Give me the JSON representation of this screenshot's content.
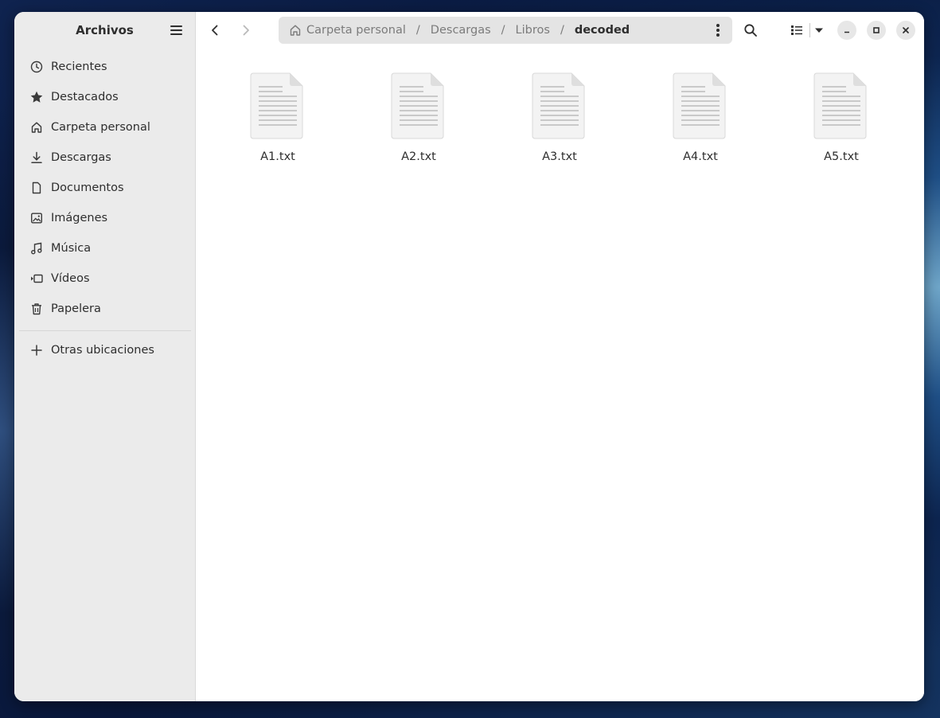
{
  "sidebar": {
    "title": "Archivos",
    "places": [
      {
        "label": "Recientes",
        "icon": "clock-icon"
      },
      {
        "label": "Destacados",
        "icon": "star-icon"
      },
      {
        "label": "Carpeta personal",
        "icon": "home-icon"
      },
      {
        "label": "Descargas",
        "icon": "download-icon"
      },
      {
        "label": "Documentos",
        "icon": "document-icon"
      },
      {
        "label": "Imágenes",
        "icon": "image-icon"
      },
      {
        "label": "Música",
        "icon": "music-icon"
      },
      {
        "label": "Vídeos",
        "icon": "video-icon"
      },
      {
        "label": "Papelera",
        "icon": "trash-icon"
      }
    ],
    "other_locations": {
      "label": "Otras ubicaciones",
      "icon": "plus-icon"
    }
  },
  "pathbar": {
    "crumbs": [
      "Carpeta personal",
      "Descargas",
      "Libros",
      "decoded"
    ],
    "separator": "/"
  },
  "files": [
    {
      "name": "A1.txt"
    },
    {
      "name": "A2.txt"
    },
    {
      "name": "A3.txt"
    },
    {
      "name": "A4.txt"
    },
    {
      "name": "A5.txt"
    }
  ]
}
